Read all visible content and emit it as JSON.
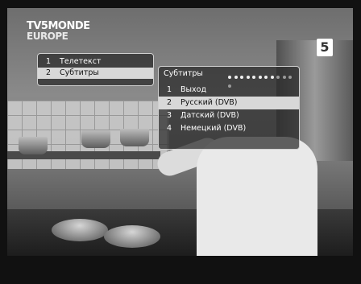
{
  "channel": {
    "logo_line1": "TV5MONDE",
    "logo_line2": "EUROPE",
    "number": "5"
  },
  "main_menu": {
    "items": [
      {
        "num": "1",
        "label": "Телетекст",
        "selected": false
      },
      {
        "num": "2",
        "label": "Субтитры",
        "selected": true
      }
    ]
  },
  "subtitles_menu": {
    "title": "Субтитры",
    "items": [
      {
        "num": "1",
        "label": "Выход",
        "selected": false
      },
      {
        "num": "2",
        "label": "Русский (DVB)",
        "selected": true
      },
      {
        "num": "3",
        "label": "Датский (DVB)",
        "selected": false
      },
      {
        "num": "4",
        "label": "Немецкий (DVB)",
        "selected": false
      }
    ],
    "page_dots_total": 12,
    "page_dots_bright": 8
  },
  "colors": {
    "selection_bg": "#d8d8d8",
    "menu_border": "#cfcfcf"
  }
}
